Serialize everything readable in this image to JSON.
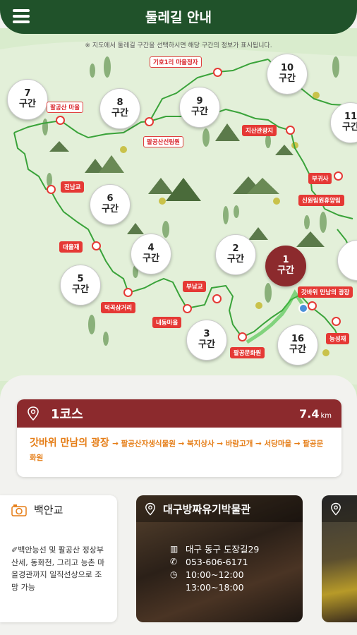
{
  "header": {
    "title": "둘레길 안내",
    "menu_icon": "hamburger-menu-icon"
  },
  "map": {
    "notice": "※ 지도에서 둘레길 구간을 선택하시면 해당 구간의 정보가 표시됩니다.",
    "sections": [
      {
        "num": "7",
        "label": "구간"
      },
      {
        "num": "8",
        "label": "구간"
      },
      {
        "num": "9",
        "label": "구간"
      },
      {
        "num": "10",
        "label": "구간"
      },
      {
        "num": "11",
        "label": "구간"
      },
      {
        "num": "6",
        "label": "구간"
      },
      {
        "num": "4",
        "label": "구간"
      },
      {
        "num": "2",
        "label": "구간"
      },
      {
        "num": "1",
        "label": "구간"
      },
      {
        "num": "5",
        "label": "구간"
      },
      {
        "num": "3",
        "label": "구간"
      },
      {
        "num": "16",
        "label": "구간"
      }
    ],
    "places": [
      "기호1리 마을정자",
      "팔공산 마을",
      "팔공산선림원",
      "지산관광지",
      "부귀사",
      "진남교",
      "신원림원휴양림",
      "대율재",
      "부남교",
      "갓바위 만남의 광장",
      "덕곡삼거리",
      "내동마을",
      "팔공문화원",
      "능성재"
    ]
  },
  "course": {
    "name": "1코스",
    "distance": "7.4",
    "unit": "km",
    "route_start": "갓바위 만남의 광장",
    "route_rest": "→ 팔공산자생식물원 → 북지상사 → 바람고개 → 서당마을 → 팔공문화원"
  },
  "cards": [
    {
      "title": "백안교",
      "icon": "camera-icon",
      "desc": "✐백안능선 및 팔공산 정상부 산세, 동화천, 그리고 능촌 마을경관까지 일직선상으로 조망 가능"
    },
    {
      "title": "대구방짜유기박물관",
      "icon": "location-pin-icon",
      "address": "대구 동구 도장길29",
      "phone": "053-606-6171",
      "hours1": "10:00~12:00",
      "hours2": "13:00~18:00"
    }
  ],
  "colors": {
    "header": "#20522a",
    "accent": "#8c2a2d",
    "route": "#3aa33a",
    "place": "#e53935",
    "map_bg": "#d9eccd"
  }
}
